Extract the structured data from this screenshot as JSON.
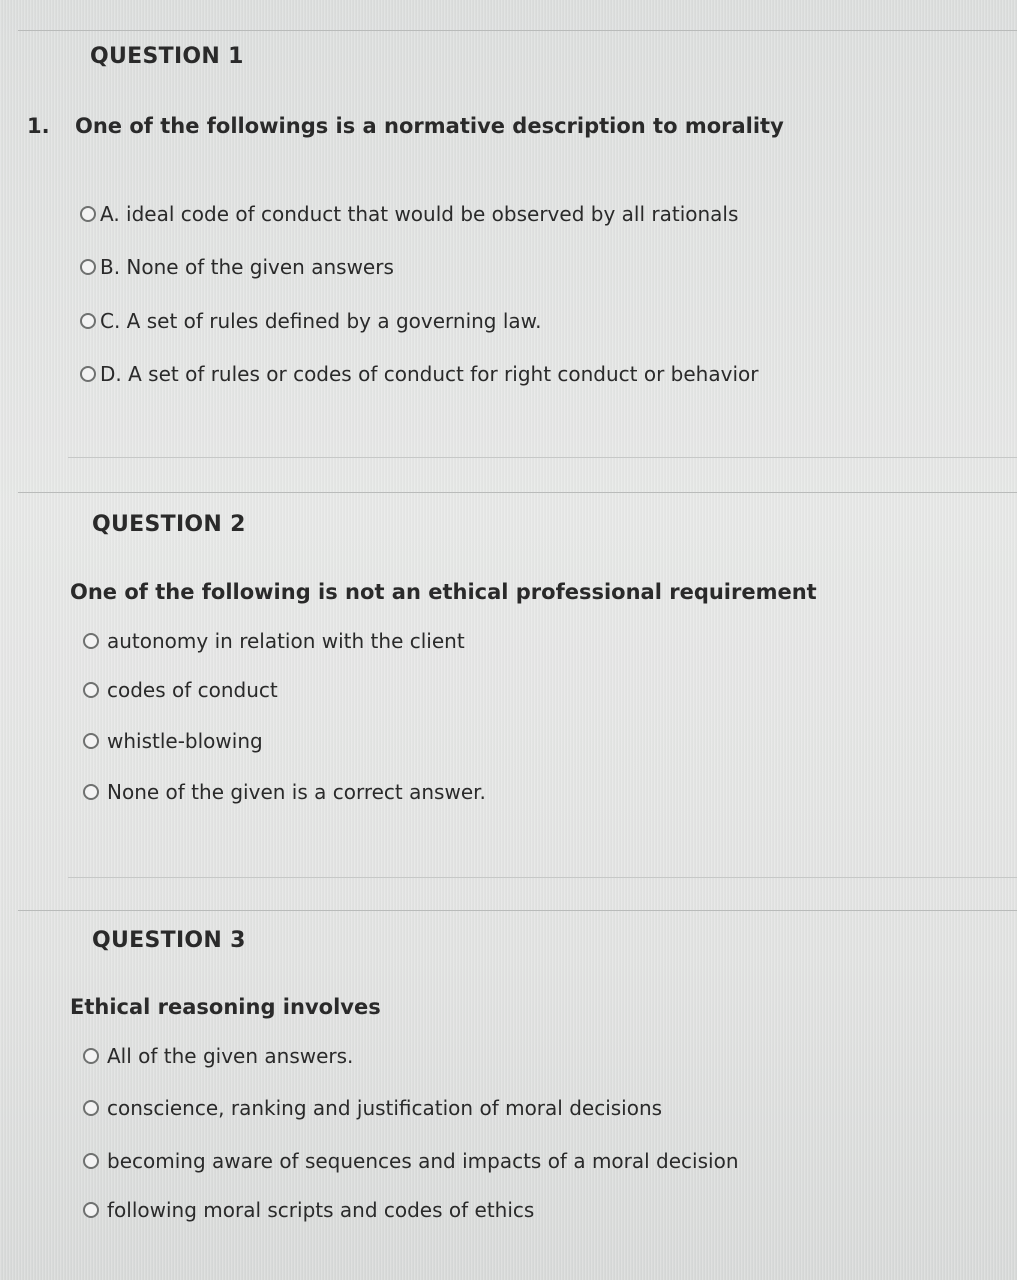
{
  "questions": [
    {
      "heading": "QUESTION 1",
      "number": "1.",
      "text": "One of the followings is a normative description to morality",
      "options": [
        "A. ideal code of conduct that would be observed by all rationals",
        "B. None of the given answers",
        "C. A set of rules defined by a governing law.",
        "D. A set of rules or codes of conduct for right conduct or behavior"
      ]
    },
    {
      "heading": "QUESTION 2",
      "text": "One of the following is not an ethical professional requirement",
      "options": [
        "autonomy in relation with the client",
        "codes of conduct",
        "whistle-blowing",
        "None of the given is a correct answer."
      ]
    },
    {
      "heading": "QUESTION 3",
      "text": "Ethical reasoning involves",
      "options": [
        "All of the given answers.",
        "conscience, ranking and justification of moral decisions",
        "becoming aware of sequences and impacts of a moral decision",
        "following moral scripts and codes of ethics"
      ]
    }
  ]
}
